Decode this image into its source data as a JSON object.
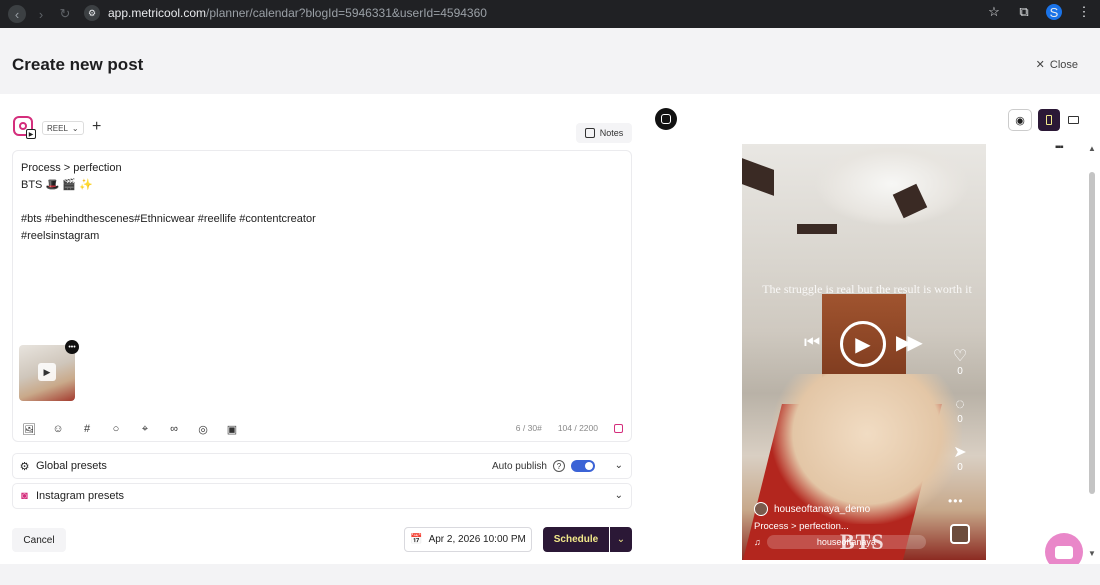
{
  "browser": {
    "url_host": "app.metricool.com",
    "url_path": "/planner/calendar?blogId=5946331&userId=4594360",
    "profile_initial": "S"
  },
  "header": {
    "title": "Create new post",
    "close_label": "Close"
  },
  "editor": {
    "post_type": "REEL",
    "notes_label": "Notes",
    "caption_lines": [
      "Process > perfection",
      "BTS 🎩 🎬 ✨",
      "",
      "#bts #behindthescenes#Ethnicwear #reellife #contentcreator",
      "#reelsinstagram"
    ],
    "hashtag_count": "6 / 30",
    "char_count": "104 / 2200",
    "toolbar_icons": [
      "media-library-icon",
      "emoji-icon",
      "hashtag-icon",
      "comment-icon",
      "location-icon",
      "link-icon",
      "ai-assistant-icon",
      "folder-icon"
    ]
  },
  "presets": {
    "global_label": "Global presets",
    "autopublish_label": "Auto publish",
    "autopublish_on": true,
    "instagram_label": "Instagram presets"
  },
  "footer": {
    "cancel_label": "Cancel",
    "date_label": "Apr 2, 2026 10:00 PM",
    "schedule_label": "Schedule"
  },
  "preview": {
    "overlay_text": "The struggle is real but the result is worth it",
    "likes": "0",
    "comments": "0",
    "shares": "0",
    "username": "houseoftanaya_demo",
    "caption_preview": "Process > perfection...",
    "audio_label": "houseoftanaya",
    "video_title_overlay": "BTS"
  },
  "colors": {
    "brand_dark": "#2b1836",
    "brand_yellow": "#f2e98a",
    "instagram_pink": "#d42e7c",
    "toggle_blue": "#3b63d6",
    "chat_pink": "#e987c9"
  }
}
